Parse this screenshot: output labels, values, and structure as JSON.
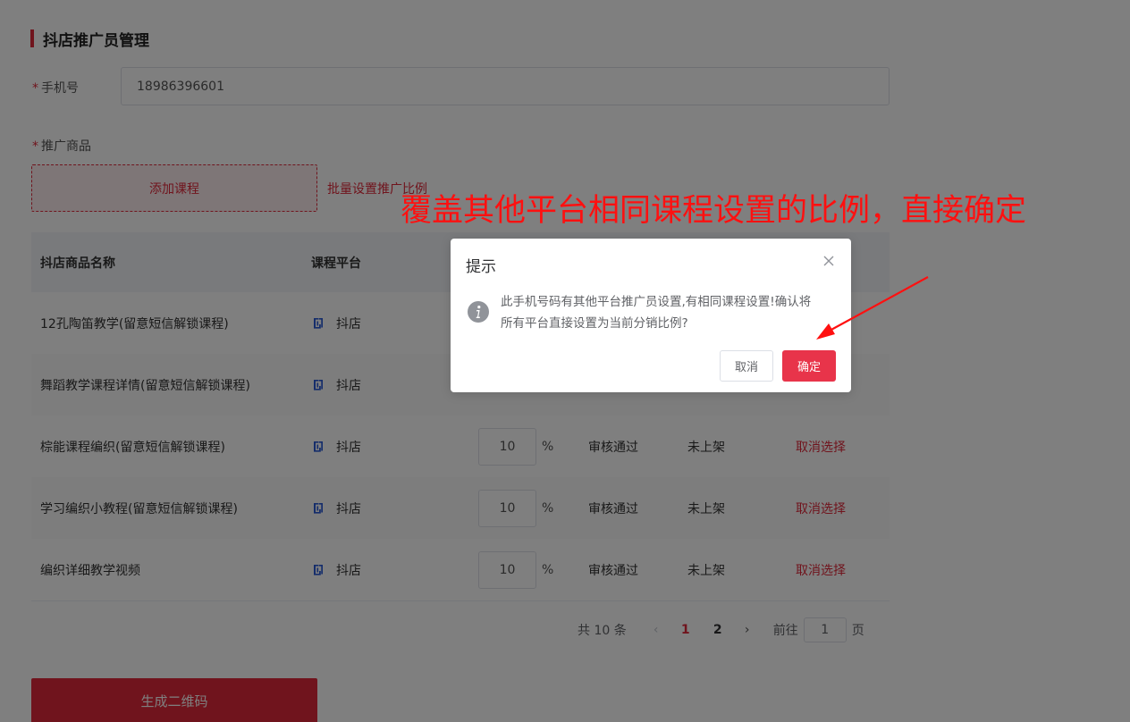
{
  "section": {
    "title": "抖店推广员管理"
  },
  "form": {
    "phone_label": "手机号",
    "phone_value": "18986396601",
    "goods_label": "推广商品",
    "required_mark": "*"
  },
  "actions": {
    "add_course": "添加课程",
    "batch_set_ratio": "批量设置推广比例",
    "generate_qr": "生成二维码"
  },
  "table": {
    "headers": {
      "name": "抖店商品名称",
      "platform": "课程平台"
    },
    "rows": [
      {
        "name": "12孔陶笛教学(留意短信解锁课程)",
        "platform": "抖店",
        "ratio": "",
        "pct": "",
        "audit": "",
        "shelf": "",
        "op": ""
      },
      {
        "name": "舞蹈教学课程详情(留意短信解锁课程)",
        "platform": "抖店",
        "ratio": "",
        "pct": "",
        "audit": "",
        "shelf": "",
        "op": ""
      },
      {
        "name": "棕能课程编织(留意短信解锁课程)",
        "platform": "抖店",
        "ratio": "10",
        "pct": "%",
        "audit": "审核通过",
        "shelf": "未上架",
        "op": "取消选择"
      },
      {
        "name": "学习编织小教程(留意短信解锁课程)",
        "platform": "抖店",
        "ratio": "10",
        "pct": "%",
        "audit": "审核通过",
        "shelf": "未上架",
        "op": "取消选择"
      },
      {
        "name": "编织详细教学视频",
        "platform": "抖店",
        "ratio": "10",
        "pct": "%",
        "audit": "审核通过",
        "shelf": "未上架",
        "op": "取消选择"
      }
    ]
  },
  "pagination": {
    "total": "共 10 条",
    "pages": [
      "1",
      "2"
    ],
    "active_page": "1",
    "goto_label": "前往",
    "goto_value": "1",
    "page_unit": "页"
  },
  "dialog": {
    "title": "提示",
    "message": "此手机号码有其他平台推广员设置,有相同课程设置!确认将所有平台直接设置为当前分销比例?",
    "cancel": "取消",
    "confirm": "确定"
  },
  "annotation": {
    "text": "覆盖其他平台相同课程设置的比例，直接确定",
    "color": "#ff1010"
  },
  "colors": {
    "accent": "#e0283a",
    "confirm_button": "#e8344a",
    "platform_icon": "#2a5bd7"
  }
}
